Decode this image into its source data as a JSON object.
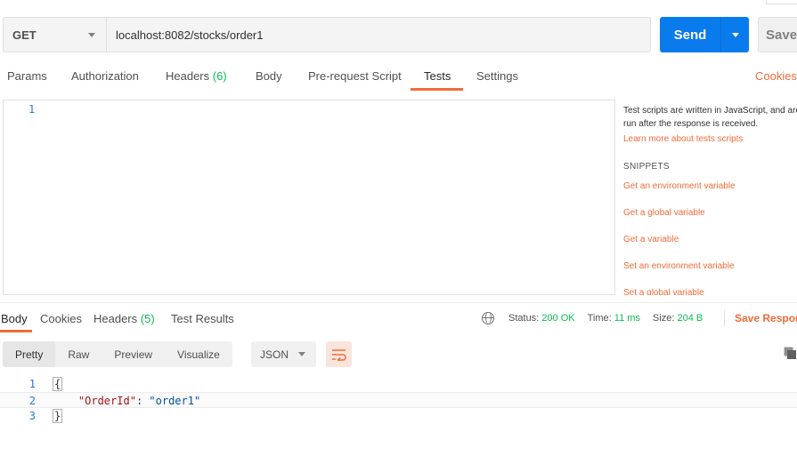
{
  "request": {
    "method": "GET",
    "url": "localhost:8082/stocks/order1",
    "send_label": "Send",
    "save_label": "Save"
  },
  "request_tabs": [
    {
      "label": "Params"
    },
    {
      "label": "Authorization"
    },
    {
      "label": "Headers",
      "count": "(6)"
    },
    {
      "label": "Body"
    },
    {
      "label": "Pre-request Script"
    },
    {
      "label": "Tests",
      "active": true
    },
    {
      "label": "Settings"
    }
  ],
  "cookies_label": "Cookies",
  "editor": {
    "line_numbers": [
      "1"
    ]
  },
  "side_panel": {
    "description": "Test scripts are written in JavaScript, and are run after the response is received.",
    "learn_link": "Learn more about tests scripts",
    "snippets_title": "SNIPPETS",
    "snippets": [
      "Get an environment variable",
      "Get a global variable",
      "Get a variable",
      "Set an environment variable",
      "Set a global variable"
    ]
  },
  "response_tabs": [
    {
      "label": "Body",
      "active": true
    },
    {
      "label": "Cookies"
    },
    {
      "label": "Headers",
      "count": "(5)"
    },
    {
      "label": "Test Results"
    }
  ],
  "response_status": {
    "status_label": "Status:",
    "status_value": "200 OK",
    "time_label": "Time:",
    "time_value": "11 ms",
    "size_label": "Size:",
    "size_value": "204 B",
    "save_response_label": "Save Response"
  },
  "view_modes": [
    "Pretty",
    "Raw",
    "Preview",
    "Visualize"
  ],
  "active_view_mode": "Pretty",
  "format": "JSON",
  "response_body": {
    "lines": [
      {
        "num": "1",
        "open": "{"
      },
      {
        "num": "2",
        "key": "\"OrderId\"",
        "sep": ": ",
        "value": "\"order1\""
      },
      {
        "num": "3",
        "close": "}"
      }
    ]
  },
  "colors": {
    "accent": "#f26b3a",
    "send_blue": "#097bed",
    "success_green": "#0cbb52"
  }
}
